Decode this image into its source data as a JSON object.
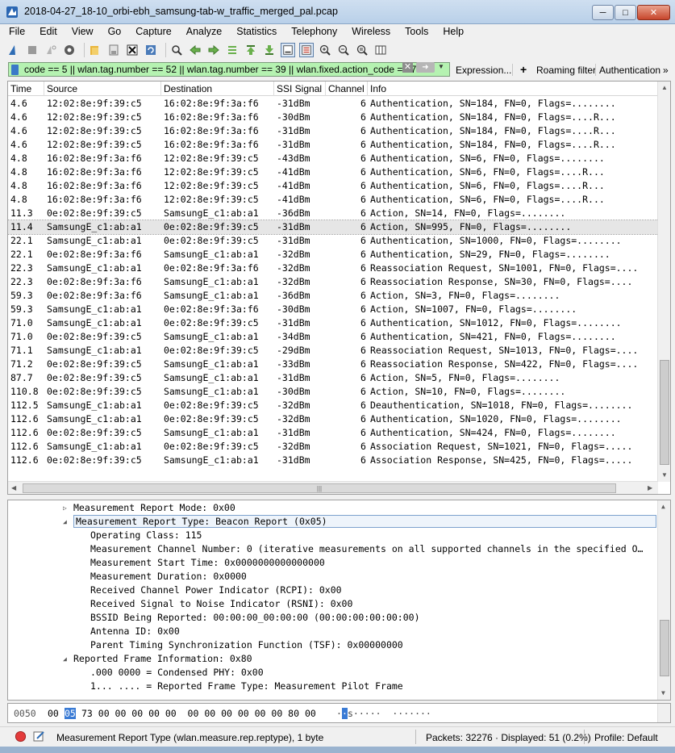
{
  "window": {
    "title": "2018-04-27_18-10_orbi-ebh_samsung-tab-w_traffic_merged_pal.pcap",
    "min_icon": "minimize-icon",
    "max_icon": "maximize-icon",
    "close_icon": "close-icon"
  },
  "menu": [
    "File",
    "Edit",
    "View",
    "Go",
    "Capture",
    "Analyze",
    "Statistics",
    "Telephony",
    "Wireless",
    "Tools",
    "Help"
  ],
  "toolbar_icons": [
    "shark-fin-start-icon",
    "stop-icon",
    "restart-icon",
    "capture-options-icon",
    "open-file-icon",
    "save-file-icon",
    "close-file-icon",
    "reload-icon",
    "find-icon",
    "back-icon",
    "forward-icon",
    "go-to-packet-icon",
    "first-packet-icon",
    "last-packet-icon",
    "autoscroll-icon",
    "colorize-icon",
    "zoom-in-icon",
    "zoom-out-icon",
    "normal-size-icon",
    "resize-columns-icon"
  ],
  "filter": {
    "text": "code == 5 || wlan.tag.number == 52 || wlan.tag.number == 39 || wlan.fixed.action_code == 7",
    "expression_label": "Expression...",
    "add_label": "+",
    "roaming_label": "Roaming filter",
    "auth_label": "Authentication",
    "more_label": "»",
    "bg_color": "#b5f2b1"
  },
  "columns": [
    "Time",
    "Source",
    "Destination",
    "SSI Signal",
    "Channel",
    "Info"
  ],
  "packets": [
    {
      "time": "4.6",
      "src": "12:02:8e:9f:39:c5",
      "dst": "16:02:8e:9f:3a:f6",
      "ssi": "-31dBm",
      "ch": "6",
      "info": "Authentication, SN=184, FN=0, Flags=........"
    },
    {
      "time": "4.6",
      "src": "12:02:8e:9f:39:c5",
      "dst": "16:02:8e:9f:3a:f6",
      "ssi": "-30dBm",
      "ch": "6",
      "info": "Authentication, SN=184, FN=0, Flags=....R..."
    },
    {
      "time": "4.6",
      "src": "12:02:8e:9f:39:c5",
      "dst": "16:02:8e:9f:3a:f6",
      "ssi": "-31dBm",
      "ch": "6",
      "info": "Authentication, SN=184, FN=0, Flags=....R..."
    },
    {
      "time": "4.6",
      "src": "12:02:8e:9f:39:c5",
      "dst": "16:02:8e:9f:3a:f6",
      "ssi": "-31dBm",
      "ch": "6",
      "info": "Authentication, SN=184, FN=0, Flags=....R..."
    },
    {
      "time": "4.8",
      "src": "16:02:8e:9f:3a:f6",
      "dst": "12:02:8e:9f:39:c5",
      "ssi": "-43dBm",
      "ch": "6",
      "info": "Authentication, SN=6, FN=0, Flags=........"
    },
    {
      "time": "4.8",
      "src": "16:02:8e:9f:3a:f6",
      "dst": "12:02:8e:9f:39:c5",
      "ssi": "-41dBm",
      "ch": "6",
      "info": "Authentication, SN=6, FN=0, Flags=....R..."
    },
    {
      "time": "4.8",
      "src": "16:02:8e:9f:3a:f6",
      "dst": "12:02:8e:9f:39:c5",
      "ssi": "-41dBm",
      "ch": "6",
      "info": "Authentication, SN=6, FN=0, Flags=....R..."
    },
    {
      "time": "4.8",
      "src": "16:02:8e:9f:3a:f6",
      "dst": "12:02:8e:9f:39:c5",
      "ssi": "-41dBm",
      "ch": "6",
      "info": "Authentication, SN=6, FN=0, Flags=....R..."
    },
    {
      "time": "11.3",
      "src": "0e:02:8e:9f:39:c5",
      "dst": "SamsungE_c1:ab:a1",
      "ssi": "-36dBm",
      "ch": "6",
      "info": "Action, SN=14, FN=0, Flags=........"
    },
    {
      "time": "11.4",
      "src": "SamsungE_c1:ab:a1",
      "dst": "0e:02:8e:9f:39:c5",
      "ssi": "-31dBm",
      "ch": "6",
      "info": "Action, SN=995, FN=0, Flags=........",
      "selected": true
    },
    {
      "time": "22.1",
      "src": "SamsungE_c1:ab:a1",
      "dst": "0e:02:8e:9f:39:c5",
      "ssi": "-31dBm",
      "ch": "6",
      "info": "Authentication, SN=1000, FN=0, Flags=........"
    },
    {
      "time": "22.1",
      "src": "0e:02:8e:9f:3a:f6",
      "dst": "SamsungE_c1:ab:a1",
      "ssi": "-32dBm",
      "ch": "6",
      "info": "Authentication, SN=29, FN=0, Flags=........"
    },
    {
      "time": "22.3",
      "src": "SamsungE_c1:ab:a1",
      "dst": "0e:02:8e:9f:3a:f6",
      "ssi": "-32dBm",
      "ch": "6",
      "info": "Reassociation Request, SN=1001, FN=0, Flags=...."
    },
    {
      "time": "22.3",
      "src": "0e:02:8e:9f:3a:f6",
      "dst": "SamsungE_c1:ab:a1",
      "ssi": "-32dBm",
      "ch": "6",
      "info": "Reassociation Response, SN=30, FN=0, Flags=...."
    },
    {
      "time": "59.3",
      "src": "0e:02:8e:9f:3a:f6",
      "dst": "SamsungE_c1:ab:a1",
      "ssi": "-36dBm",
      "ch": "6",
      "info": "Action, SN=3, FN=0, Flags=........"
    },
    {
      "time": "59.3",
      "src": "SamsungE_c1:ab:a1",
      "dst": "0e:02:8e:9f:3a:f6",
      "ssi": "-30dBm",
      "ch": "6",
      "info": "Action, SN=1007, FN=0, Flags=........"
    },
    {
      "time": "71.0",
      "src": "SamsungE_c1:ab:a1",
      "dst": "0e:02:8e:9f:39:c5",
      "ssi": "-31dBm",
      "ch": "6",
      "info": "Authentication, SN=1012, FN=0, Flags=........"
    },
    {
      "time": "71.0",
      "src": "0e:02:8e:9f:39:c5",
      "dst": "SamsungE_c1:ab:a1",
      "ssi": "-34dBm",
      "ch": "6",
      "info": "Authentication, SN=421, FN=0, Flags=........"
    },
    {
      "time": "71.1",
      "src": "SamsungE_c1:ab:a1",
      "dst": "0e:02:8e:9f:39:c5",
      "ssi": "-29dBm",
      "ch": "6",
      "info": "Reassociation Request, SN=1013, FN=0, Flags=...."
    },
    {
      "time": "71.2",
      "src": "0e:02:8e:9f:39:c5",
      "dst": "SamsungE_c1:ab:a1",
      "ssi": "-33dBm",
      "ch": "6",
      "info": "Reassociation Response, SN=422, FN=0, Flags=...."
    },
    {
      "time": "87.7",
      "src": "0e:02:8e:9f:39:c5",
      "dst": "SamsungE_c1:ab:a1",
      "ssi": "-31dBm",
      "ch": "6",
      "info": "Action, SN=5, FN=0, Flags=........"
    },
    {
      "time": "110.8",
      "src": "0e:02:8e:9f:39:c5",
      "dst": "SamsungE_c1:ab:a1",
      "ssi": "-30dBm",
      "ch": "6",
      "info": "Action, SN=10, FN=0, Flags=........"
    },
    {
      "time": "112.5",
      "src": "SamsungE_c1:ab:a1",
      "dst": "0e:02:8e:9f:39:c5",
      "ssi": "-32dBm",
      "ch": "6",
      "info": "Deauthentication, SN=1018, FN=0, Flags=........"
    },
    {
      "time": "112.6",
      "src": "SamsungE_c1:ab:a1",
      "dst": "0e:02:8e:9f:39:c5",
      "ssi": "-32dBm",
      "ch": "6",
      "info": "Authentication, SN=1020, FN=0, Flags=........"
    },
    {
      "time": "112.6",
      "src": "0e:02:8e:9f:39:c5",
      "dst": "SamsungE_c1:ab:a1",
      "ssi": "-31dBm",
      "ch": "6",
      "info": "Authentication, SN=424, FN=0, Flags=........"
    },
    {
      "time": "112.6",
      "src": "SamsungE_c1:ab:a1",
      "dst": "0e:02:8e:9f:39:c5",
      "ssi": "-32dBm",
      "ch": "6",
      "info": "Association Request, SN=1021, FN=0, Flags=....."
    },
    {
      "time": "112.6",
      "src": "0e:02:8e:9f:39:c5",
      "dst": "SamsungE_c1:ab:a1",
      "ssi": "-31dBm",
      "ch": "6",
      "info": "Association Response, SN=425, FN=0, Flags=....."
    }
  ],
  "details": [
    {
      "text": "Measurement Report Mode: 0x00",
      "level": 0,
      "twisty": "collapsed"
    },
    {
      "text": "Measurement Report Type: Beacon Report (0x05)",
      "level": 0,
      "twisty": "expanded",
      "selected": true
    },
    {
      "text": "Operating Class: 115",
      "level": 1,
      "twisty": "none"
    },
    {
      "text": "Measurement Channel Number: 0 (iterative measurements on all supported channels in the specified O…",
      "level": 1,
      "twisty": "none"
    },
    {
      "text": "Measurement Start Time: 0x0000000000000000",
      "level": 1,
      "twisty": "none"
    },
    {
      "text": "Measurement Duration: 0x0000",
      "level": 1,
      "twisty": "none"
    },
    {
      "text": "Received Channel Power Indicator (RCPI): 0x00",
      "level": 1,
      "twisty": "none"
    },
    {
      "text": "Received Signal to Noise Indicator (RSNI): 0x00",
      "level": 1,
      "twisty": "none"
    },
    {
      "text": "BSSID Being Reported: 00:00:00_00:00:00 (00:00:00:00:00:00)",
      "level": 1,
      "twisty": "none"
    },
    {
      "text": "Antenna ID: 0x00",
      "level": 1,
      "twisty": "none"
    },
    {
      "text": "Parent Timing Synchronization Function (TSF): 0x00000000",
      "level": 1,
      "twisty": "none"
    },
    {
      "text": "Reported Frame Information: 0x80",
      "level": 0,
      "twisty": "expanded"
    },
    {
      "text": ".000 0000 = Condensed PHY: 0x00",
      "level": 1,
      "twisty": "none"
    },
    {
      "text": "1... .... = Reported Frame Type: Measurement Pilot Frame",
      "level": 1,
      "twisty": "none"
    }
  ],
  "bytes": {
    "offset": "0050",
    "hex_before": "00",
    "hex_sel": "05",
    "hex_after": "73 00 00 00 00 00  00 00 00 00 00 00 80 00",
    "ascii_before": "·",
    "ascii_sel": "·",
    "ascii_after": "s·····  ·······"
  },
  "status": {
    "field_info": "Measurement Report Type (wlan.measure.rep.reptype), 1 byte",
    "packets_label": "Packets: 32276 · Displayed: 51 (0.2%)",
    "profile_label": "Profile: Default"
  }
}
